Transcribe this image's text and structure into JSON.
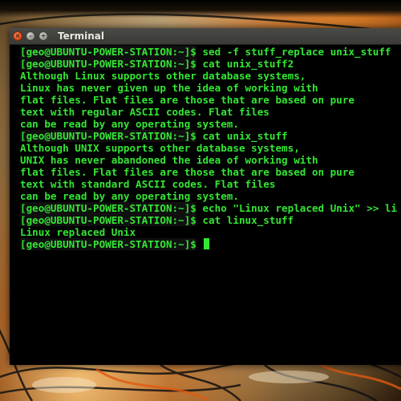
{
  "window": {
    "title": "Terminal"
  },
  "terminal": {
    "lines": [
      {
        "kind": "prompt",
        "prompt": "[geo@UBUNTU-POWER-STATION:~]$",
        "command": " sed -f stuff_replace unix_stuff"
      },
      {
        "kind": "prompt",
        "prompt": "[geo@UBUNTU-POWER-STATION:~]$",
        "command": " cat unix_stuff2"
      },
      {
        "kind": "output",
        "text": "Although Linux supports other database systems,"
      },
      {
        "kind": "output",
        "text": "Linux has never given up the idea of working with"
      },
      {
        "kind": "output",
        "text": "flat files. Flat files are those that are based on pure"
      },
      {
        "kind": "output",
        "text": "text with regular ASCII codes. Flat files"
      },
      {
        "kind": "output",
        "text": "can be read by any operating system."
      },
      {
        "kind": "prompt",
        "prompt": "[geo@UBUNTU-POWER-STATION:~]$",
        "command": " cat unix_stuff"
      },
      {
        "kind": "output",
        "text": "Although UNIX supports other database systems,"
      },
      {
        "kind": "output",
        "text": "UNIX has never abandoned the idea of working with"
      },
      {
        "kind": "output",
        "text": "flat files. Flat files are those that are based on pure"
      },
      {
        "kind": "output",
        "text": "text with standard ASCII codes. Flat files"
      },
      {
        "kind": "output",
        "text": "can be read by any operating system."
      },
      {
        "kind": "prompt",
        "prompt": "[geo@UBUNTU-POWER-STATION:~]$",
        "command": " echo \"Linux replaced Unix\" >> li"
      },
      {
        "kind": "prompt",
        "prompt": "[geo@UBUNTU-POWER-STATION:~]$",
        "command": " cat linux_stuff"
      },
      {
        "kind": "output",
        "text": "Linux replaced Unix"
      },
      {
        "kind": "prompt",
        "prompt": "[geo@UBUNTU-POWER-STATION:~]$",
        "command": " ",
        "cursor": true
      }
    ]
  },
  "colors": {
    "terminal_text": "#33e633",
    "terminal_bg": "#000000",
    "close_button": "#e0461a"
  },
  "icons": {
    "close": "close-icon",
    "minimize": "minimize-icon",
    "maximize": "maximize-icon"
  }
}
